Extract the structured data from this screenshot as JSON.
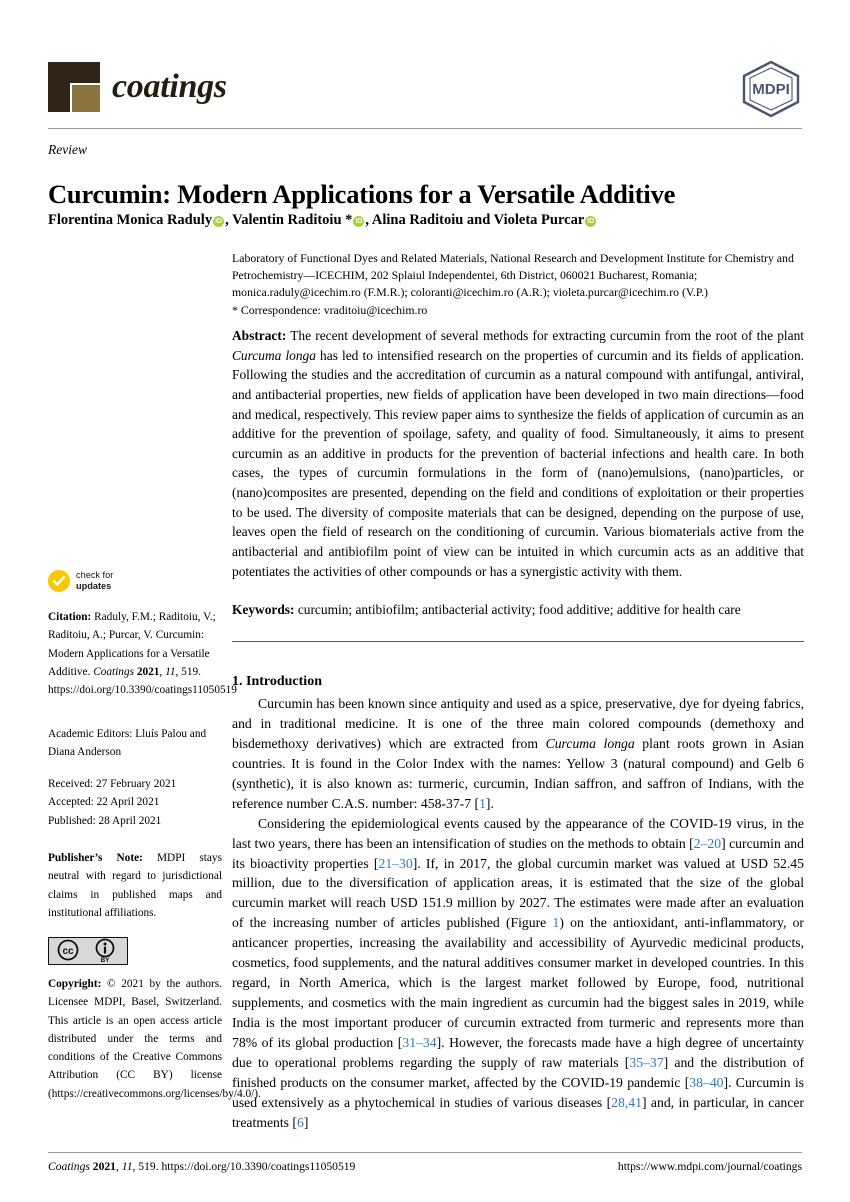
{
  "journal": {
    "name": "coatings",
    "publisher_logo_text": "MDPI"
  },
  "header": {
    "doctype": "Review",
    "title": "Curcumin: Modern Applications for a Versatile Additive"
  },
  "authors": {
    "line_parts": [
      "Florentina Monica Raduly",
      ", ",
      "Valentin Raditoiu *",
      ", Alina Raditoiu and Violeta Purcar",
      ""
    ],
    "orcid_glyph": "iD"
  },
  "affiliation": {
    "line1": "Laboratory of Functional Dyes and Related Materials, National Research and Development Institute for",
    "line2": "Chemistry and Petrochemistry—ICECHIM, 202 Splaiul Independentei, 6th District, 060021 Bucharest, Romania;",
    "line3": "monica.raduly@icechim.ro (F.M.R.); coloranti@icechim.ro (A.R.); violeta.purcar@icechim.ro (V.P.)",
    "correspondence": "*   Correspondence: vraditoiu@icechim.ro"
  },
  "abstract": {
    "label": "Abstract:",
    "part1": " The recent development of several methods for extracting curcumin from the root of the plant ",
    "italic1": "Curcuma longa",
    "part2": " has led to intensified research on the properties of curcumin and its fields of application. Following the studies and the accreditation of curcumin as a natural compound with antifungal, antiviral, and antibacterial properties, new fields of application have been developed in two main directions—food and medical, respectively. This review paper aims to synthesize the fields of application of curcumin as an additive for the prevention of spoilage, safety, and quality of food. Simultaneously, it aims to present curcumin as an additive in products for the prevention of bacterial infections and health care. In both cases, the types of curcumin formulations in the form of (nano)emulsions, (nano)particles, or (nano)composites are presented, depending on the field and conditions of exploitation or their properties to be used. The diversity of composite materials that can be designed, depending on the purpose of use, leaves open the field of research on the conditioning of curcumin. Various biomaterials active from the antibacterial and antibiofilm point of view can be intuited in which curcumin acts as an additive that potentiates the activities of other compounds or has a synergistic activity with them."
  },
  "keywords": {
    "label": "Keywords:",
    "text": " curcumin; antibiofilm; antibacterial activity; food additive; additive for health care"
  },
  "introduction": {
    "heading": "1. Introduction",
    "p1_a": "Curcumin has been known since antiquity and used as a spice, preservative, dye for dyeing fabrics, and in traditional medicine. It is one of the three main colored compounds (demethoxy and bisdemethoxy derivatives) which are extracted from ",
    "p1_italic": "Curcuma longa",
    "p1_b": " plant roots grown in Asian countries. It is found in the Color Index with the names: Yellow 3 (natural compound) and Gelb 6 (synthetic), it is also known as: turmeric, curcumin, Indian saffron, and saffron of Indians, with the reference number C.A.S. number: 458-37-7 [",
    "p1_ref1": "1",
    "p1_c": "].",
    "p2_a": "Considering the epidemiological events caused by the appearance of the COVID-19 virus, in the last two years, there has been an intensification of studies on the methods to obtain [",
    "p2_ref1": "2–20",
    "p2_b": "] curcumin and its bioactivity properties [",
    "p2_ref2": "21–30",
    "p2_c": "]. If, in 2017, the global curcumin market was valued at USD 52.45 million, due to the diversification of application areas, it is estimated that the size of the global curcumin market will reach USD 151.9 million by 2027. The estimates were made after an evaluation of the increasing number of articles published (Figure ",
    "p2_figref": "1",
    "p2_d": ") on the antioxidant, anti-inflammatory, or anticancer properties, increasing the availability and accessibility of Ayurvedic medicinal products, cosmetics, food supplements, and the natural additives consumer market in developed countries. In this regard, in North America, which is the largest market followed by Europe, food, nutritional supplements, and cosmetics with the main ingredient as curcumin had the biggest sales in 2019, while India is the most important producer of curcumin extracted from turmeric and represents more than 78% of its global production [",
    "p2_ref3": "31–34",
    "p2_e": "]. However, the forecasts made have a high degree of uncertainty due to operational problems regarding the supply of raw materials [",
    "p2_ref4": "35–37",
    "p2_f": "] and the distribution of finished products on the consumer market, affected by the COVID-19 pandemic [",
    "p2_ref5": "38–40",
    "p2_g": "]. Curcumin is used extensively as a phytochemical in studies of various diseases [",
    "p2_ref6": "28,41",
    "p2_h": "] and, in particular, in cancer treatments [",
    "p2_ref7": "6",
    "p2_i": "]"
  },
  "sidebar": {
    "check_updates_line1": "check for",
    "check_updates_line2": "updates",
    "citation_label": "Citation:",
    "citation_text_a": "  Raduly, F.M.; Raditoiu, V.; Raditoiu, A.; Purcar, V. Curcumin: Modern Applications for a Versatile Additive. ",
    "citation_journal": "Coatings",
    "citation_year": " 2021",
    "citation_vol": ", 11",
    "citation_pages": ", 519. ",
    "citation_doi": "https://doi.org/10.3390/coatings11050519",
    "editors": "Academic Editors: Lluís Palou and Diana Anderson",
    "received": "Received: 27 February 2021",
    "accepted": "Accepted: 22 April 2021",
    "published": "Published: 28 April 2021",
    "pubnote_label": "Publisher’s Note:",
    "pubnote_text": " MDPI stays neutral with regard to jurisdictional claims in published maps and institutional affiliations.",
    "cc_badge_cc": "cc",
    "cc_badge_by": "BY",
    "copyright_label": "Copyright:",
    "copyright_text": " © 2021 by the authors. Licensee MDPI, Basel, Switzerland. This article is an open access article distributed under the terms and conditions of the Creative Commons Attribution (CC BY) license (https://creativecommons.org/licenses/by/4.0/)."
  },
  "footer": {
    "journal_italic": "Coatings",
    "year_bold": " 2021",
    "vol_italic": ", 11",
    "rest": ", 519. https://doi.org/10.3390/coatings11050519",
    "url": "https://www.mdpi.com/journal/coatings"
  },
  "colors": {
    "logo_dark": "#2e2518",
    "logo_gold": "#8b7340",
    "mdpi_blue": "#4a5472",
    "orcid_green": "#a6ce39",
    "check_yellow": "#f9c800",
    "reference_link": "#2a7cc7"
  }
}
